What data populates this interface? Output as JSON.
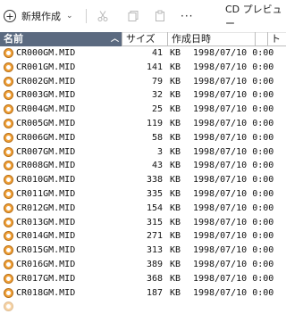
{
  "toolbar": {
    "new_label": "新規作成",
    "chevron": "⌄",
    "cut_icon": "scissors-icon",
    "copy_icon": "copy-icon",
    "paste_icon": "paste-icon",
    "more": "···",
    "cd_preview_label": "CD プレビュー"
  },
  "header": {
    "name": "名前",
    "sort_indicator": "︿",
    "size": "サイズ",
    "date": "作成日時",
    "type": "ト"
  },
  "colors": {
    "header_selected": "#5b6a80",
    "file_icon": "#f1a23a"
  },
  "files": [
    {
      "name": "CR000GM.MID",
      "size": "41",
      "unit": "KB",
      "date": "1998/07/10 0:00"
    },
    {
      "name": "CR001GM.MID",
      "size": "141",
      "unit": "KB",
      "date": "1998/07/10 0:00"
    },
    {
      "name": "CR002GM.MID",
      "size": "79",
      "unit": "KB",
      "date": "1998/07/10 0:00"
    },
    {
      "name": "CR003GM.MID",
      "size": "32",
      "unit": "KB",
      "date": "1998/07/10 0:00"
    },
    {
      "name": "CR004GM.MID",
      "size": "25",
      "unit": "KB",
      "date": "1998/07/10 0:00"
    },
    {
      "name": "CR005GM.MID",
      "size": "119",
      "unit": "KB",
      "date": "1998/07/10 0:00"
    },
    {
      "name": "CR006GM.MID",
      "size": "58",
      "unit": "KB",
      "date": "1998/07/10 0:00"
    },
    {
      "name": "CR007GM.MID",
      "size": "3",
      "unit": "KB",
      "date": "1998/07/10 0:00"
    },
    {
      "name": "CR008GM.MID",
      "size": "43",
      "unit": "KB",
      "date": "1998/07/10 0:00"
    },
    {
      "name": "CR010GM.MID",
      "size": "338",
      "unit": "KB",
      "date": "1998/07/10 0:00"
    },
    {
      "name": "CR011GM.MID",
      "size": "335",
      "unit": "KB",
      "date": "1998/07/10 0:00"
    },
    {
      "name": "CR012GM.MID",
      "size": "154",
      "unit": "KB",
      "date": "1998/07/10 0:00"
    },
    {
      "name": "CR013GM.MID",
      "size": "315",
      "unit": "KB",
      "date": "1998/07/10 0:00"
    },
    {
      "name": "CR014GM.MID",
      "size": "271",
      "unit": "KB",
      "date": "1998/07/10 0:00"
    },
    {
      "name": "CR015GM.MID",
      "size": "313",
      "unit": "KB",
      "date": "1998/07/10 0:00"
    },
    {
      "name": "CR016GM.MID",
      "size": "389",
      "unit": "KB",
      "date": "1998/07/10 0:00"
    },
    {
      "name": "CR017GM.MID",
      "size": "368",
      "unit": "KB",
      "date": "1998/07/10 0:00"
    },
    {
      "name": "CR018GM.MID",
      "size": "187",
      "unit": "KB",
      "date": "1998/07/10 0:00"
    }
  ]
}
